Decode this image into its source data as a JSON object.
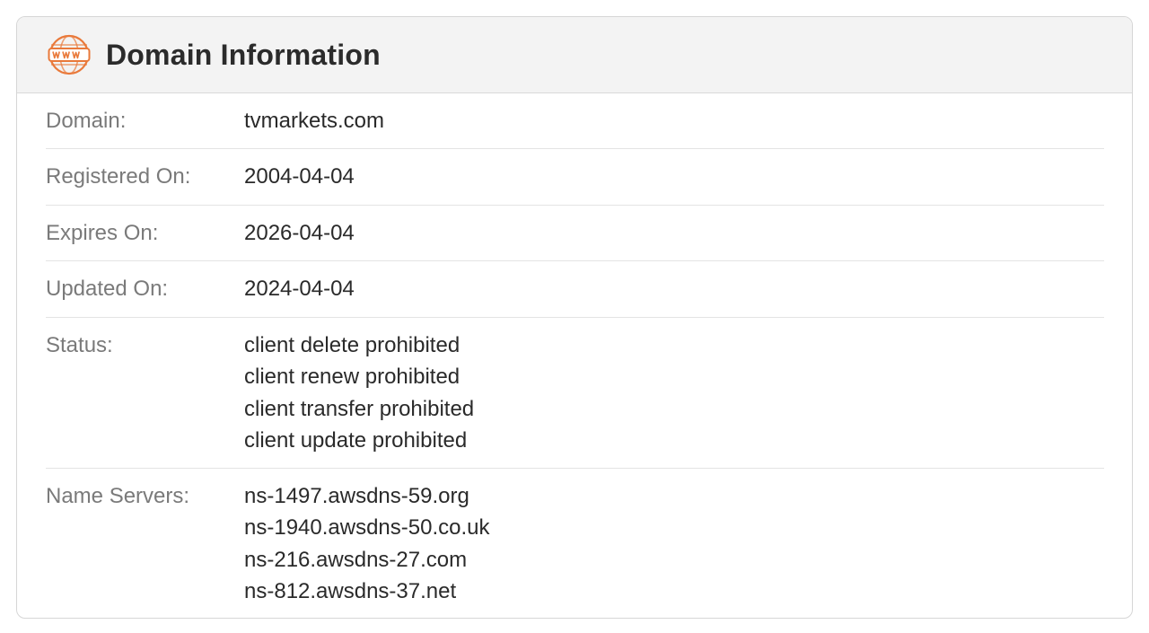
{
  "panel": {
    "title": "Domain Information",
    "icon": "www-globe-icon",
    "accent_color": "#e9793a"
  },
  "rows": [
    {
      "label": "Domain:",
      "values": [
        "tvmarkets.com"
      ]
    },
    {
      "label": "Registered On:",
      "values": [
        "2004-04-04"
      ]
    },
    {
      "label": "Expires On:",
      "values": [
        "2026-04-04"
      ]
    },
    {
      "label": "Updated On:",
      "values": [
        "2024-04-04"
      ]
    },
    {
      "label": "Status:",
      "values": [
        "client delete prohibited",
        "client renew prohibited",
        "client transfer prohibited",
        "client update prohibited"
      ]
    },
    {
      "label": "Name Servers:",
      "values": [
        "ns-1497.awsdns-59.org",
        "ns-1940.awsdns-50.co.uk",
        "ns-216.awsdns-27.com",
        "ns-812.awsdns-37.net"
      ]
    }
  ]
}
